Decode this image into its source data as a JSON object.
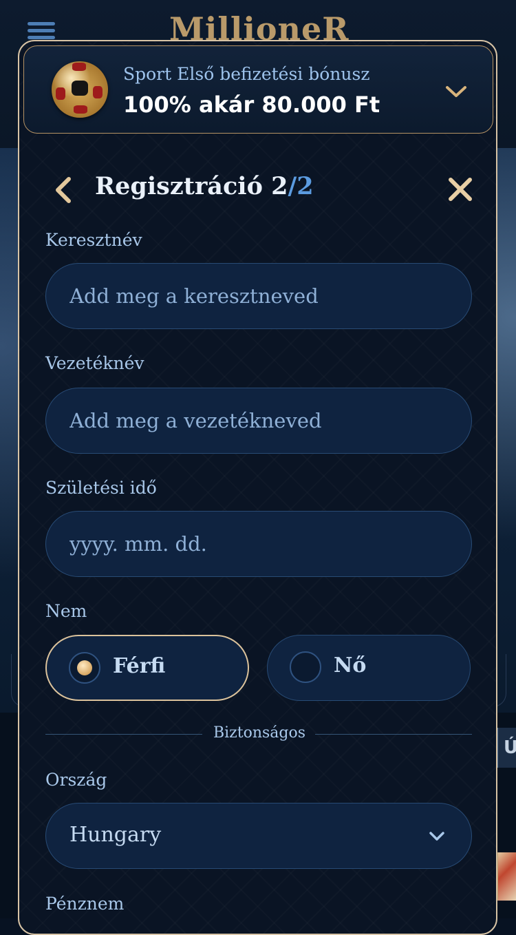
{
  "app": {
    "brand_name": "MillioneR"
  },
  "bonus": {
    "subtitle": "Sport Első befizetési bónusz",
    "title": "100% akár 80.000 Ft"
  },
  "header": {
    "title_main": "Regisztráció 2",
    "title_sep": "/",
    "title_total": "2"
  },
  "form": {
    "first_name": {
      "label": "Keresztnév",
      "placeholder": "Add meg a keresztneved",
      "value": ""
    },
    "last_name": {
      "label": "Vezetéknév",
      "placeholder": "Add meg a vezetékneved",
      "value": ""
    },
    "birth_date": {
      "label": "Születési idő",
      "placeholder": "yyyy. mm. dd.",
      "value": ""
    },
    "gender": {
      "label": "Nem",
      "options": [
        {
          "label": "Férfi",
          "selected": true
        },
        {
          "label": "Nő",
          "selected": false
        }
      ]
    },
    "divider": "Biztonságos",
    "country": {
      "label": "Ország",
      "value": "Hungary"
    },
    "currency": {
      "label": "Pénznem"
    }
  },
  "background": {
    "side_tab_label": "Ú"
  },
  "colors": {
    "accent_gold": "#d8c4a6",
    "accent_blue": "#5b9be0",
    "input_bg": "#0f2340",
    "modal_bg": "#0a1424"
  }
}
